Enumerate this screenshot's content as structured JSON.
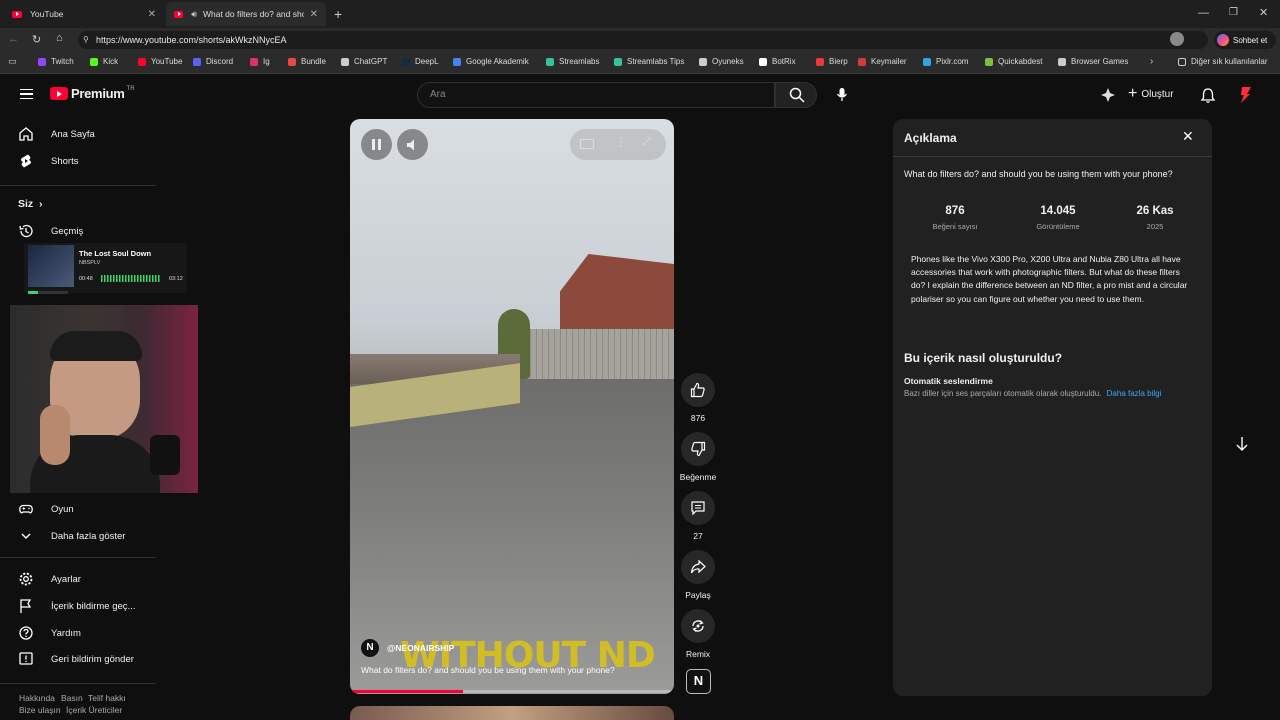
{
  "browser": {
    "tabs": [
      {
        "title": "YouTube"
      },
      {
        "title": "What do filters do? and shou"
      }
    ],
    "url": "https://www.youtube.com/shorts/akWkzNNycEA",
    "bookmarks": [
      {
        "label": "Twitch",
        "color": "#9146ff"
      },
      {
        "label": "Kick",
        "color": "#53fc18"
      },
      {
        "label": "YouTube",
        "color": "#ff0033"
      },
      {
        "label": "Discord",
        "color": "#5865f2"
      },
      {
        "label": "Ig",
        "color": "#e1306c"
      },
      {
        "label": "Bundle",
        "color": "#e84a3c"
      },
      {
        "label": "ChatGPT",
        "color": "#cccccc"
      },
      {
        "label": "DeepL",
        "color": "#0f2b46"
      },
      {
        "label": "Google Akademik",
        "color": "#4285f4"
      },
      {
        "label": "Streamlabs",
        "color": "#31c3a2"
      },
      {
        "label": "Streamlabs Tips",
        "color": "#31c3a2"
      },
      {
        "label": "Oyuneks",
        "color": "#cccccc"
      },
      {
        "label": "BotRix",
        "color": "#ffffff"
      },
      {
        "label": "Bierp",
        "color": "#e83a3a"
      },
      {
        "label": "Keymailer",
        "color": "#d43a3a"
      },
      {
        "label": "Pixlr.com",
        "color": "#2ea7e0"
      },
      {
        "label": "Quickabdest",
        "color": "#7bc043"
      },
      {
        "label": "Browser Games",
        "color": "#cccccc"
      }
    ],
    "other_bookmarks": "Diğer sık kullanılanlar",
    "chat_label": "Sohbet et"
  },
  "header": {
    "logo": "Premium",
    "logo_sup": "TR",
    "search_placeholder": "Ara",
    "create_label": "Oluştur"
  },
  "sidebar": {
    "items": [
      {
        "label": "Ana Sayfa"
      },
      {
        "label": "Shorts"
      }
    ],
    "you_header": "Siz",
    "history": "Geçmiş",
    "gaming": "Oyun",
    "show_more": "Daha fazla göster",
    "settings": [
      {
        "label": "Ayarlar"
      },
      {
        "label": "İçerik bildirme geç..."
      },
      {
        "label": "Yardım"
      },
      {
        "label": "Geri bildirim gönder"
      }
    ],
    "footer": [
      "Hakkında",
      "Basın",
      "Telif hakkı",
      "Bize ulaşın",
      "İçerik Üreticiler"
    ]
  },
  "music_widget": {
    "title": "The Lost Soul Down",
    "artist": "NBSPLV",
    "elapsed": "00:48",
    "total": "03:12",
    "progress": 0.25
  },
  "video": {
    "channel": "@NEONAIRSHIP",
    "caption": "What do filters do? and should you be using them with your phone?",
    "overlay_text": "WITHOUT ND",
    "progress": 0.35
  },
  "actions": {
    "likes": "876",
    "dislike_label": "Beğenme",
    "comments": "27",
    "share_label": "Paylaş",
    "remix_label": "Remix"
  },
  "description": {
    "heading": "Açıklama",
    "title": "What do filters do? and should you be using them with your phone?",
    "stats": [
      {
        "value": "876",
        "label": "Beğeni sayısı"
      },
      {
        "value": "14.045",
        "label": "Görüntüleme"
      },
      {
        "value": "26 Kas",
        "label": "2025"
      }
    ],
    "body": "Phones like the Vivo X300 Pro, X200 Ultra and Nubia Z80 Ultra all have accessories that work with photographic filters. But what do these filters do?  I explain the difference between an ND filter, a pro mist and a circular polariser so you can figure out whether you need to use them.",
    "how_made_heading": "Bu içerik nasıl oluşturuldu?",
    "auto_dub_title": "Otomatik seslendirme",
    "auto_dub_text": "Bazı diller için ses parçaları otomatik olarak oluşturuldu.",
    "learn_more": "Daha fazla bilgi"
  }
}
